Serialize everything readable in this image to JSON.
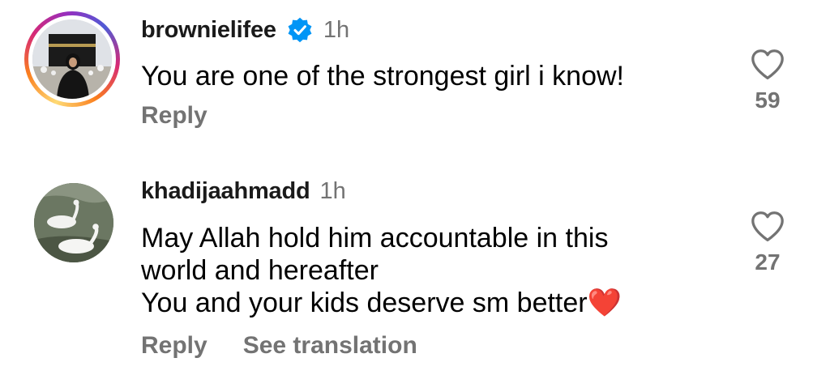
{
  "comments": [
    {
      "username": "brownielifee",
      "verified": true,
      "time": "1h",
      "lines": [
        "You are one of the strongest girl i know!"
      ],
      "actions": {
        "reply": "Reply"
      },
      "likes": "59",
      "avatar_icon": "story-ring-avatar"
    },
    {
      "username": "khadijaahmadd",
      "verified": false,
      "time": "1h",
      "lines": [
        "May Allah hold him accountable in this",
        "world and hereafter",
        "You and your kids deserve sm better❤️"
      ],
      "actions": {
        "reply": "Reply",
        "translate": "See translation"
      },
      "likes": "27",
      "avatar_icon": "swans-avatar"
    }
  ],
  "colors": {
    "verified_blue": "#0095f6",
    "muted": "#737373",
    "heart_outline": "#737373"
  }
}
